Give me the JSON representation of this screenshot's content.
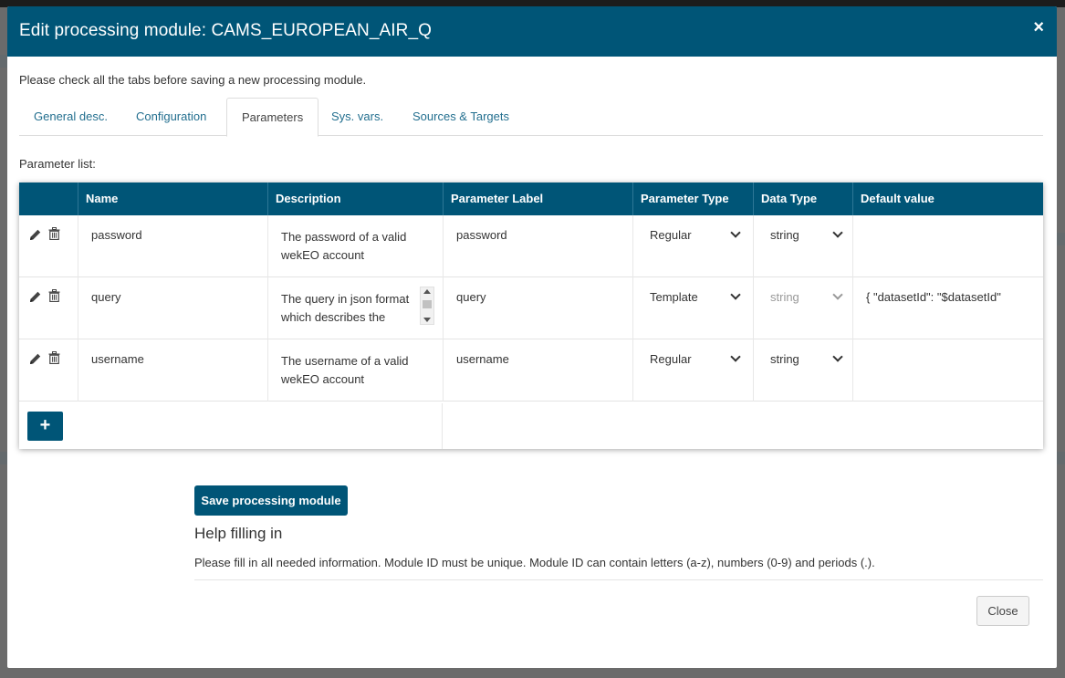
{
  "modal": {
    "title": "Edit processing module: CAMS_EUROPEAN_AIR_Q",
    "close_glyph": "×",
    "intro": "Please check all the tabs before saving a new processing module."
  },
  "tabs": [
    {
      "label": "General desc.",
      "active": false
    },
    {
      "label": "Configuration",
      "active": false
    },
    {
      "label": "Parameters",
      "active": true
    },
    {
      "label": "Sys. vars.",
      "active": false
    },
    {
      "label": "Sources & Targets",
      "active": false
    }
  ],
  "parameters": {
    "list_label": "Parameter list:",
    "columns": [
      "Name",
      "Description",
      "Parameter Label",
      "Parameter Type",
      "Data Type",
      "Default value"
    ],
    "rows": [
      {
        "name": "password",
        "description": "The password of a valid wekEO account",
        "label": "password",
        "param_type": "Regular",
        "data_type": "string",
        "data_type_disabled": false,
        "default_value": ""
      },
      {
        "name": "query",
        "description": "The query in json format which describes the",
        "label": "query",
        "param_type": "Template",
        "data_type": "string",
        "data_type_disabled": true,
        "default_value": "{ \"datasetId\": \"$datasetId\""
      },
      {
        "name": "username",
        "description": "The username of a valid wekEO account",
        "label": "username",
        "param_type": "Regular",
        "data_type": "string",
        "data_type_disabled": false,
        "default_value": ""
      }
    ],
    "add_glyph": "+"
  },
  "actions": {
    "save_label": "Save processing module",
    "close_label": "Close"
  },
  "help": {
    "title": "Help filling in",
    "text": "Please fill in all needed information. Module ID must be unique. Module ID can contain letters (a-z), numbers (0-9) and periods (.)."
  },
  "icons": {
    "edit": "pencil-icon",
    "delete": "trash-icon",
    "dropdown": "chevron-down-icon"
  },
  "colors": {
    "header_bg": "#005577",
    "tab_link": "#236f8f",
    "backdrop": "#6b6b6b"
  }
}
